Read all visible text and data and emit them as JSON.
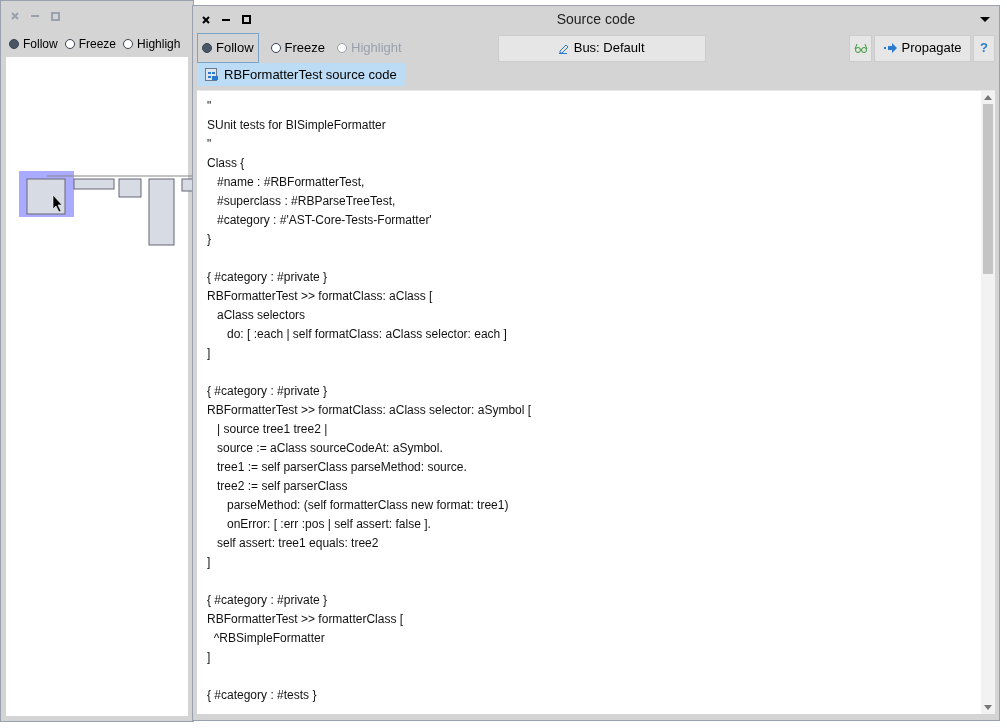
{
  "back_window": {
    "radios": [
      {
        "label": "Follow",
        "selected": true,
        "disabled": false
      },
      {
        "label": "Freeze",
        "selected": false,
        "disabled": false
      },
      {
        "label": "Highligh",
        "selected": false,
        "disabled": false
      }
    ]
  },
  "window": {
    "title": "Source code",
    "radios": [
      {
        "label": "Follow",
        "selected": true,
        "disabled": false
      },
      {
        "label": "Freeze",
        "selected": false,
        "disabled": false
      },
      {
        "label": "Highlight",
        "selected": false,
        "disabled": true
      }
    ],
    "bus_button": "Bus: Default",
    "propagate_button": "Propagate",
    "help_button": "?",
    "tabs": [
      {
        "label": "RBFormatterTest source code",
        "selected": true
      }
    ],
    "code_blocks": [
      [
        "\"",
        "SUnit tests for BISimpleFormatter",
        "\"",
        "Class {",
        "\t#name : #RBFormatterTest,",
        "\t#superclass : #RBParseTreeTest,",
        "\t#category : #'AST-Core-Tests-Formatter'",
        "}"
      ],
      [
        "{ #category : #private }",
        "RBFormatterTest >> formatClass: aClass [",
        "\taClass selectors",
        "\t\tdo: [ :each | self formatClass: aClass selector: each ]",
        "]"
      ],
      [
        "{ #category : #private }",
        "RBFormatterTest >> formatClass: aClass selector: aSymbol [",
        "\t| source tree1 tree2 |",
        "\tsource := aClass sourceCodeAt: aSymbol.",
        "\ttree1 := self parserClass parseMethod: source.",
        "\ttree2 := self parserClass",
        "\t\tparseMethod: (self formatterClass new format: tree1)",
        "\t\tonError: [ :err :pos | self assert: false ].",
        "\tself assert: tree1 equals: tree2",
        "]"
      ],
      [
        "{ #category : #private }",
        "RBFormatterTest >> formatterClass [",
        "  ^RBSimpleFormatter",
        "]"
      ],
      [
        "{ #category : #tests }"
      ]
    ]
  }
}
